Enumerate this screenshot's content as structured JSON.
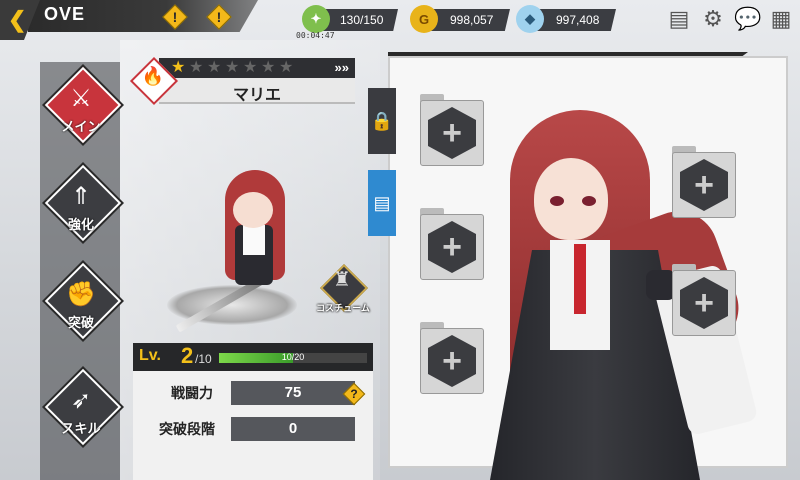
{
  "header": {
    "title": "OVE",
    "back_glyph": "❮",
    "warning_glyph": "!",
    "stamina": "130/150",
    "stamina_timer": "00:04:47",
    "gold": "998,057",
    "gems": "997,408",
    "icons": [
      "notice-icon",
      "gear-icon",
      "chat-icon",
      "grid-menu-icon"
    ]
  },
  "sidenav": {
    "items": [
      {
        "label": "メイン",
        "icon": "main-icon",
        "active": true
      },
      {
        "label": "強化",
        "icon": "upgrade-icon"
      },
      {
        "label": "突破",
        "icon": "breakthrough-icon"
      },
      {
        "label": "スキル",
        "icon": "skill-icon"
      }
    ]
  },
  "character": {
    "name": "マリエ",
    "stars_filled": 1,
    "stars_total": 7,
    "element_icon": "fire-icon",
    "costume_label": "コスチューム",
    "level_label": "Lv.",
    "level": "2",
    "level_max": "/10",
    "xp_text": "10/20",
    "xp_fraction": 0.5
  },
  "stats": {
    "power_label": "戦闘力",
    "power_value": "75",
    "help_glyph": "?",
    "breakthrough_label": "突破段階",
    "breakthrough_value": "0"
  },
  "equipment": {
    "side_tabs": [
      "lock-icon",
      "document-icon"
    ],
    "slot_glyph": "+",
    "slots": [
      "empty",
      "empty",
      "empty",
      "empty",
      "empty"
    ]
  },
  "colors": {
    "accent": "#c8343c",
    "gold": "#f3c01a",
    "dark": "#2a2a2a"
  }
}
